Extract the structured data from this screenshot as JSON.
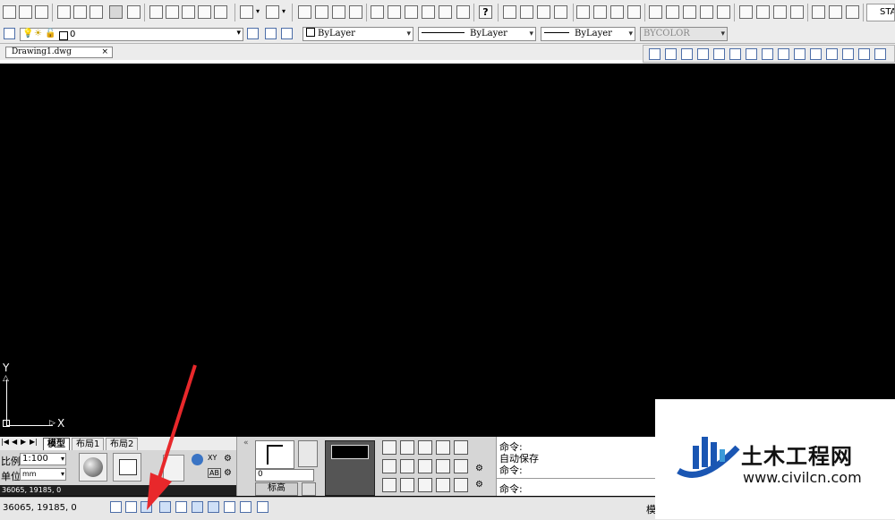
{
  "toolbar_top": {
    "help_label": "?",
    "style_label": "STA"
  },
  "layer_bar": {
    "layer_value": "0",
    "color_value": "ByLayer",
    "linetype_value": "ByLayer",
    "lineweight_value": "ByLayer",
    "plotstyle_value": "BYCOLOR"
  },
  "document": {
    "tab_title": "Drawing1.dwg",
    "close_glyph": "×"
  },
  "ucs": {
    "y_label": "Y",
    "x_label": "X"
  },
  "layout_tabs": [
    {
      "label": "模型"
    },
    {
      "label": "布局1"
    },
    {
      "label": "布局2"
    }
  ],
  "scale_panel": {
    "scale_label": "比例",
    "scale_value": "1:100",
    "unit_label": "单位",
    "unit_value": "mm",
    "xy_label": "XY",
    "ab_label": "AB"
  },
  "coordinates": "36065, 19185, 0",
  "elevation_panel": {
    "value": "0",
    "label": "标高",
    "collapse_glyph": "«"
  },
  "command_window": {
    "line1": "命令:",
    "line2": "自动保存",
    "line3": "命令:",
    "line4": "命令:"
  },
  "status_bar": {
    "coords": "36065, 19185, 0",
    "model_label": "模"
  },
  "watermark": {
    "brand": "土木工程网",
    "url": "www.civilcn.com"
  },
  "colors": {
    "canvas": "#000000",
    "toolbar": "#ececec",
    "arrow": "#e8282b",
    "logo_blue": "#1a56b3"
  }
}
